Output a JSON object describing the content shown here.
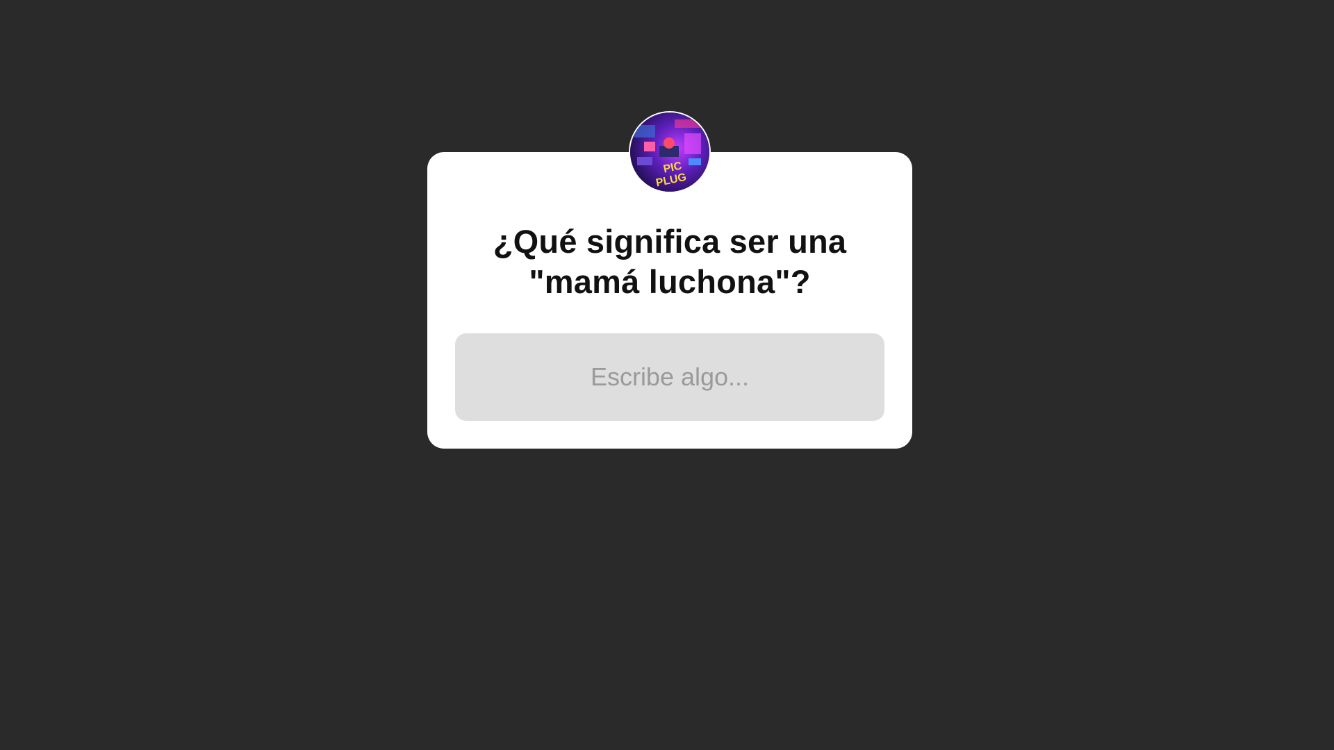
{
  "question_sticker": {
    "question_lines": [
      "¿Qué significa ser una",
      "\"mamá luchona\"?"
    ],
    "answer_placeholder": "Escribe algo...",
    "avatar": {
      "icon": "profile-avatar-icon",
      "logo_text": [
        "PIC",
        "PLUG"
      ]
    }
  },
  "colors": {
    "background": "#2a2a2a",
    "card": "#ffffff",
    "field": "#dedede",
    "placeholder": "#9a9a9a",
    "text": "#111111"
  }
}
